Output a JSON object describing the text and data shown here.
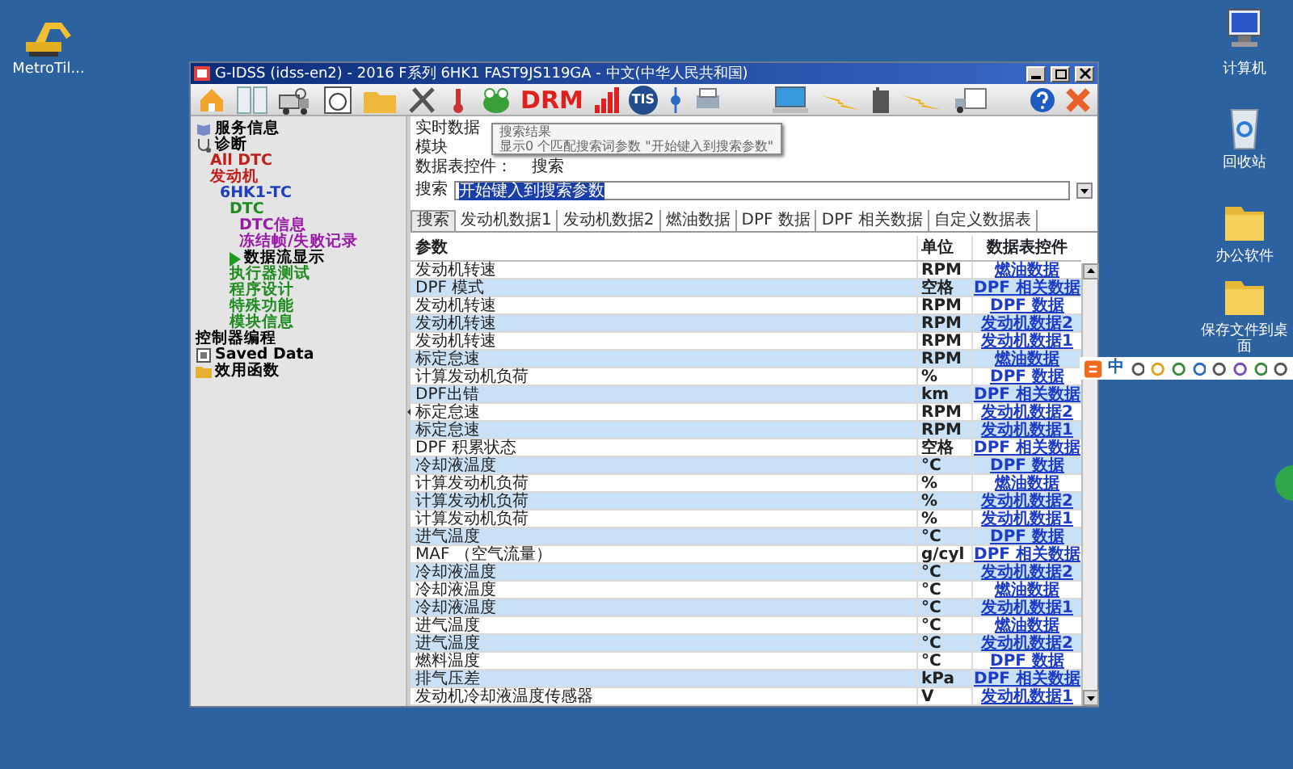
{
  "desktop_icons": [
    {
      "label": "MetroTil..."
    },
    {
      "label": "计算机"
    },
    {
      "label": "回收站"
    },
    {
      "label": "办公软件"
    },
    {
      "label": "保存文件到桌面"
    }
  ],
  "window": {
    "title": "G-IDSS (idss-en2) - 2016 F系列 6HK1 FAST9JS119GA - 中文(中华人民共和国)"
  },
  "toolbar": {
    "drm": "DRM",
    "tis": "TIS"
  },
  "tree": [
    {
      "label": "服务信息",
      "color": "#000000",
      "selected": false
    },
    {
      "label": "诊断",
      "color": "#000000",
      "selected": false,
      "children": [
        {
          "label": "All DTC",
          "color": "#c0201c",
          "selected": false
        },
        {
          "label": "发动机",
          "color": "#c0201c",
          "selected": false,
          "children": [
            {
              "label": "6HK1-TC",
              "color": "#1f3fc0",
              "selected": false,
              "children": [
                {
                  "label": "DTC",
                  "color": "#1e8c1e",
                  "selected": false,
                  "children": [
                    {
                      "label": "DTC信息",
                      "color": "#9a1aa8",
                      "selected": false
                    },
                    {
                      "label": "冻结帧/失败记录",
                      "color": "#9a1aa8",
                      "selected": false
                    }
                  ]
                },
                {
                  "label": "数据流显示",
                  "color": "#000000",
                  "selected": true
                },
                {
                  "label": "执行器测试",
                  "color": "#1e8c1e",
                  "selected": false
                },
                {
                  "label": "程序设计",
                  "color": "#1e8c1e",
                  "selected": false
                },
                {
                  "label": "特殊功能",
                  "color": "#1e8c1e",
                  "selected": false
                },
                {
                  "label": "模块信息",
                  "color": "#1e8c1e",
                  "selected": false
                }
              ]
            }
          ]
        }
      ]
    },
    {
      "label": "控制器编程",
      "color": "#000000",
      "selected": false
    },
    {
      "label": "Saved Data",
      "color": "#000000",
      "selected": false
    },
    {
      "label": "效用函数",
      "color": "#000000",
      "selected": false
    }
  ],
  "form": {
    "realtime_label": "实时数据",
    "module_label": "模块",
    "datatable_label": "数据表控件：",
    "datatable_value": "搜索",
    "search_label": "搜索",
    "search_value": "开始键入到搜索参数"
  },
  "tooltip": {
    "title": "搜索结果",
    "text": "显示0 个匹配搜索词参数 \"开始键入到搜索参数\""
  },
  "tabs": [
    {
      "label": "搜索",
      "selected": true
    },
    {
      "label": "发动机数据1",
      "selected": false
    },
    {
      "label": "发动机数据2",
      "selected": false
    },
    {
      "label": "燃油数据",
      "selected": false
    },
    {
      "label": "DPF 数据",
      "selected": false
    },
    {
      "label": "DPF 相关数据",
      "selected": false
    },
    {
      "label": "自定义数据表",
      "selected": false
    }
  ],
  "table": {
    "columns": [
      "参数",
      "单位",
      "数据表控件"
    ],
    "rows": [
      {
        "param": "发动机转速",
        "unit": "RPM",
        "link": "燃油数据"
      },
      {
        "param": "DPF 模式",
        "unit": "空格",
        "link": "DPF 相关数据"
      },
      {
        "param": "发动机转速",
        "unit": "RPM",
        "link": "DPF 数据"
      },
      {
        "param": "发动机转速",
        "unit": "RPM",
        "link": "发动机数据2"
      },
      {
        "param": "发动机转速",
        "unit": "RPM",
        "link": "发动机数据1"
      },
      {
        "param": "标定怠速",
        "unit": "RPM",
        "link": "燃油数据"
      },
      {
        "param": "计算发动机负荷",
        "unit": "%",
        "link": "DPF 数据"
      },
      {
        "param": "DPF出错",
        "unit": "km",
        "link": "DPF 相关数据"
      },
      {
        "param": "标定怠速",
        "unit": "RPM",
        "link": "发动机数据2"
      },
      {
        "param": "标定怠速",
        "unit": "RPM",
        "link": "发动机数据1"
      },
      {
        "param": "DPF 积累状态",
        "unit": "空格",
        "link": "DPF 相关数据"
      },
      {
        "param": "冷却液温度",
        "unit": "°C",
        "link": "DPF 数据"
      },
      {
        "param": "计算发动机负荷",
        "unit": "%",
        "link": "燃油数据"
      },
      {
        "param": "计算发动机负荷",
        "unit": "%",
        "link": "发动机数据2"
      },
      {
        "param": "计算发动机负荷",
        "unit": "%",
        "link": "发动机数据1"
      },
      {
        "param": "进气温度",
        "unit": "°C",
        "link": "DPF 数据"
      },
      {
        "param": "MAF （空气流量）",
        "unit": "g/cyl",
        "link": "DPF 相关数据"
      },
      {
        "param": "冷却液温度",
        "unit": "°C",
        "link": "发动机数据2"
      },
      {
        "param": "冷却液温度",
        "unit": "°C",
        "link": "燃油数据"
      },
      {
        "param": "冷却液温度",
        "unit": "°C",
        "link": "发动机数据1"
      },
      {
        "param": "进气温度",
        "unit": "°C",
        "link": "燃油数据"
      },
      {
        "param": "进气温度",
        "unit": "°C",
        "link": "发动机数据2"
      },
      {
        "param": "燃料温度",
        "unit": "°C",
        "link": "DPF 数据"
      },
      {
        "param": "排气压差",
        "unit": "kPa",
        "link": "DPF 相关数据"
      },
      {
        "param": "发动机冷却液温度传感器",
        "unit": "V",
        "link": "发动机数据1"
      }
    ]
  },
  "ime_bar": {
    "mode": "中"
  }
}
